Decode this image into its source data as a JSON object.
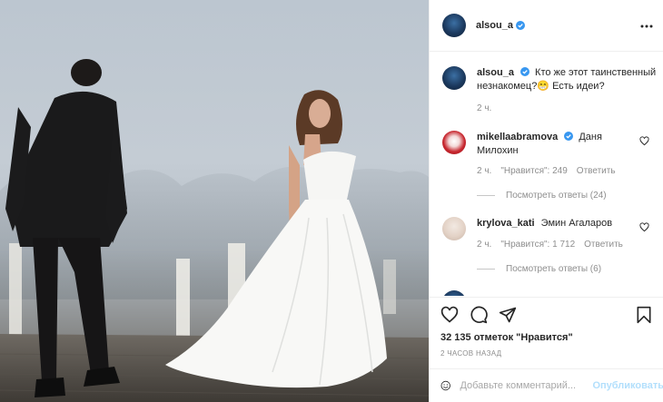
{
  "post": {
    "author": "alsou_a",
    "verified": true,
    "caption_text": "Кто же этот таинственный незнакомец?😁 Есть идеи?",
    "caption_time": "2 ч.",
    "likes": "32 135 отметок \"Нравится\"",
    "time_ago": "2 ЧАСОВ НАЗАД"
  },
  "comments": [
    {
      "username": "mikellaabramova",
      "verified": true,
      "text": "Даня Милохин",
      "time": "2 ч.",
      "likes": "\"Нравится\": 249",
      "reply_label": "Ответить",
      "view_replies": "Посмотреть ответы (24)"
    },
    {
      "username": "krylova_kati",
      "verified": false,
      "text": "Эмин Агаларов",
      "time": "2 ч.",
      "likes": "\"Нравится\": 1 712",
      "reply_label": "Ответить",
      "view_replies": "Посмотреть ответы (6)"
    }
  ],
  "add_comment": {
    "placeholder": "Добавьте комментарий...",
    "publish_label": "Опубликовать"
  },
  "icons": {
    "like": "heart-icon",
    "comment": "comment-icon",
    "share": "share-icon",
    "save": "bookmark-icon",
    "more": "more-options-icon",
    "emoji": "emoji-icon",
    "verified": "verified-badge-icon"
  },
  "colors": {
    "verified": "#3897f0",
    "publish": "#b2dffc",
    "muted": "#8e8e8e"
  }
}
